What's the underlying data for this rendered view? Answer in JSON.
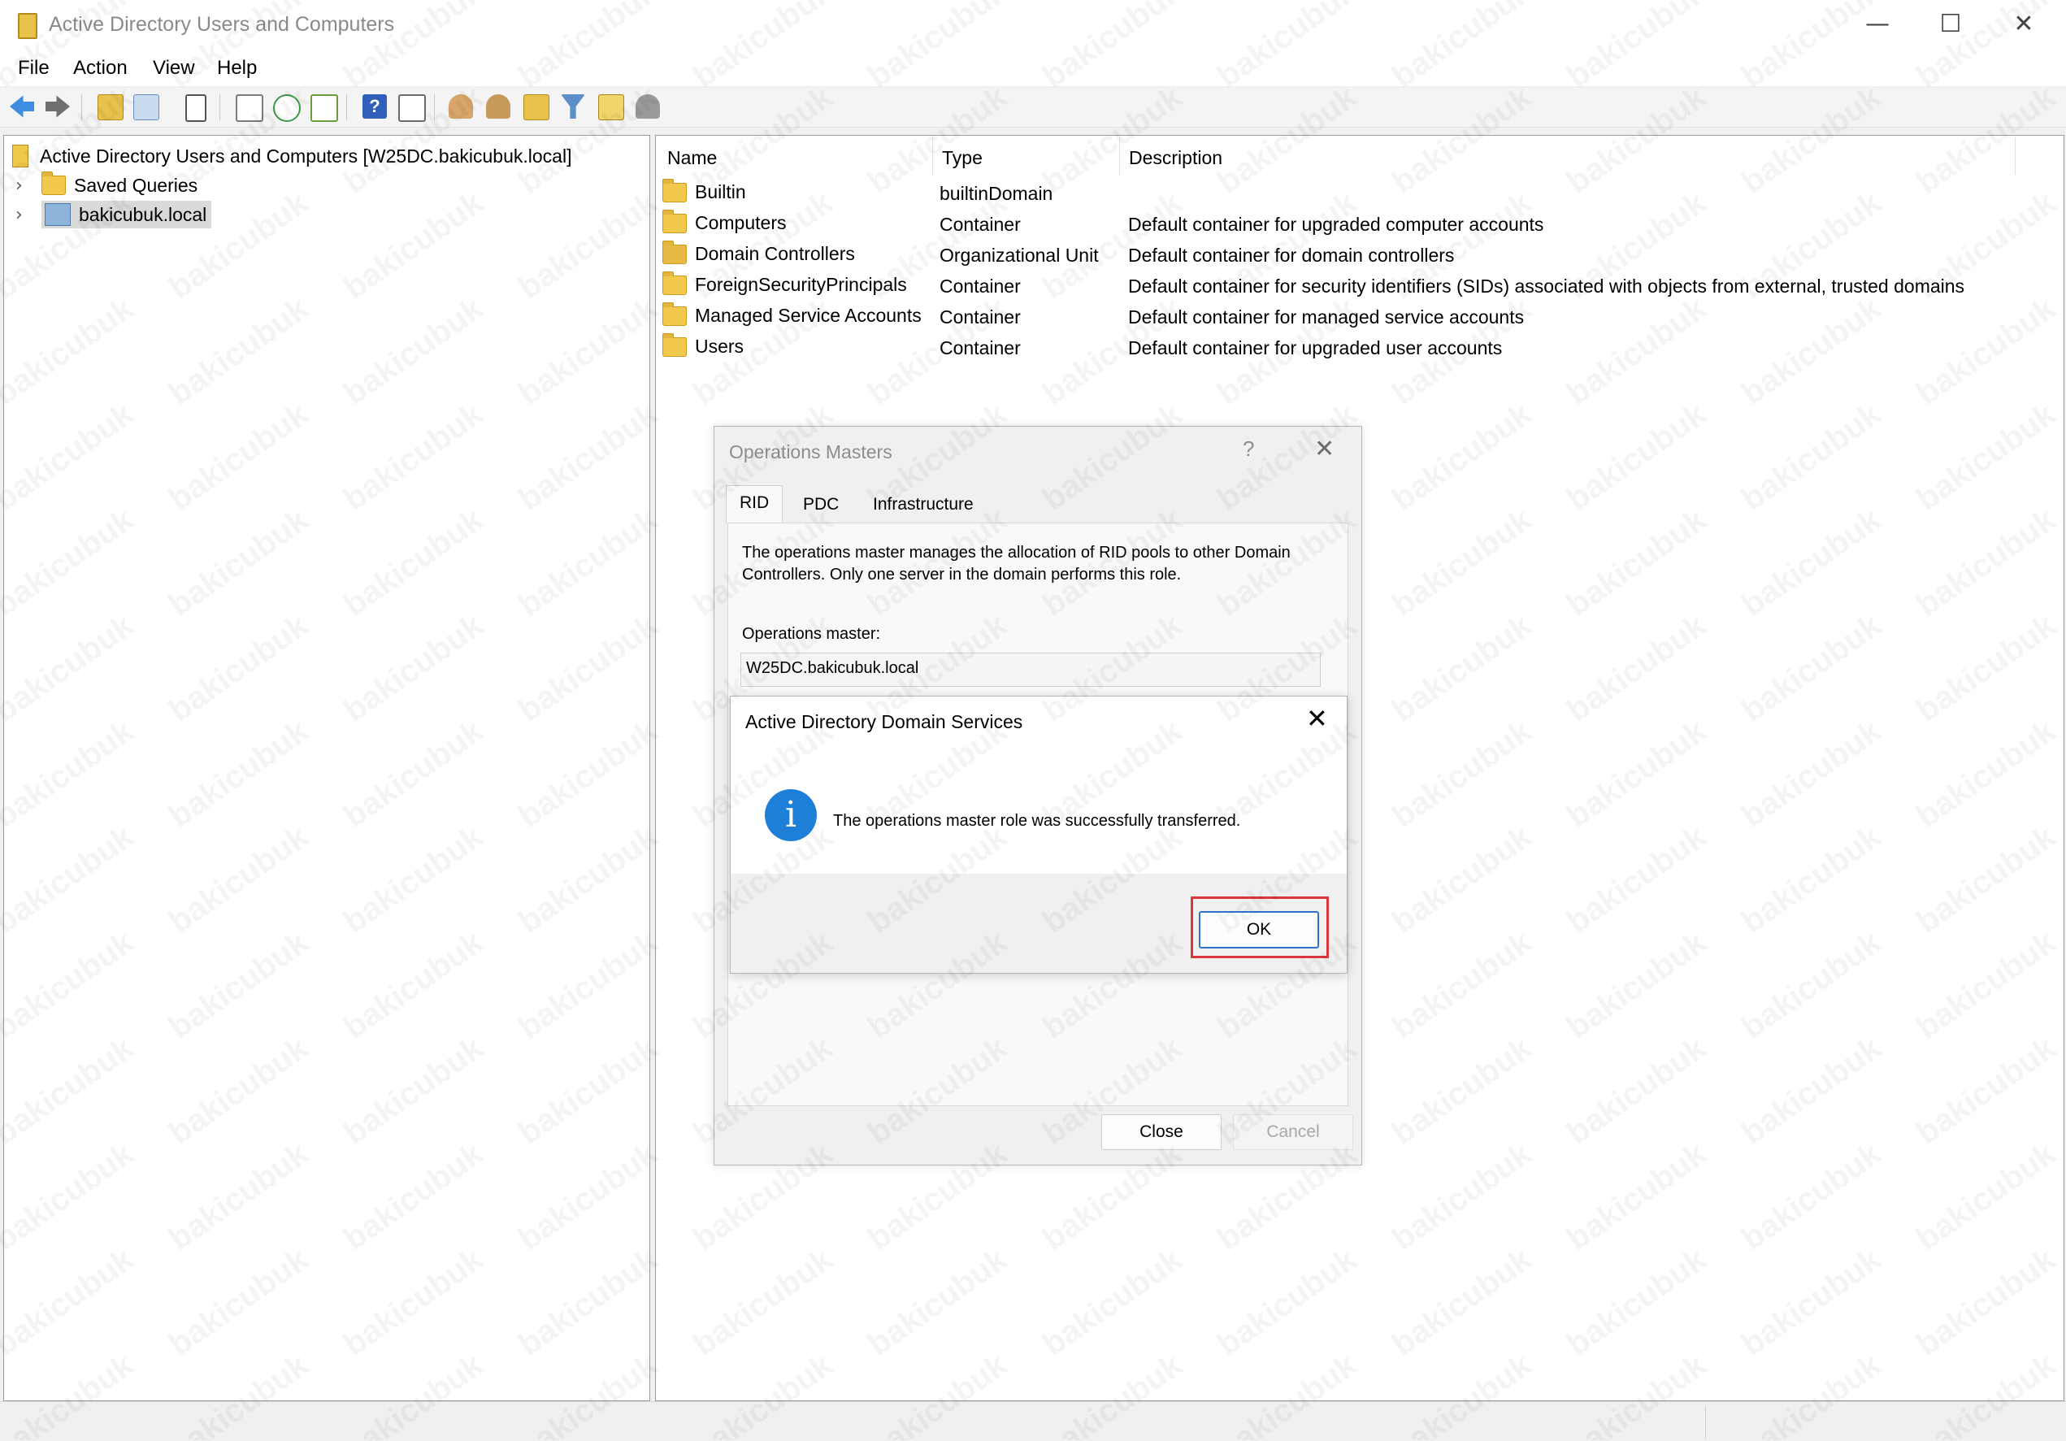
{
  "window": {
    "title": "Active Directory Users and Computers",
    "controls": {
      "minimize": "—",
      "maximize": "☐",
      "close": "✕"
    }
  },
  "menu": [
    "File",
    "Action",
    "View",
    "Help"
  ],
  "toolbar_icons": [
    "back-arrow-icon",
    "forward-arrow-icon",
    "up-folder-icon",
    "show-console-tree-icon",
    "clipboard-icon",
    "properties-icon",
    "refresh-icon",
    "export-list-icon",
    "help-icon",
    "show-action-pane-icon",
    "new-user-icon",
    "new-group-icon",
    "new-ou-icon",
    "filter-icon",
    "find-icon",
    "delegate-icon"
  ],
  "tree": {
    "root": "Active Directory Users and Computers [W25DC.bakicubuk.local]",
    "items": [
      {
        "label": "Saved Queries",
        "icon": "folder-icon"
      },
      {
        "label": "bakicubuk.local",
        "icon": "domain-icon",
        "selected": true
      }
    ]
  },
  "list": {
    "columns": [
      "Name",
      "Type",
      "Description"
    ],
    "rows": [
      {
        "name": "Builtin",
        "type": "builtinDomain",
        "description": ""
      },
      {
        "name": "Computers",
        "type": "Container",
        "description": "Default container for upgraded computer accounts"
      },
      {
        "name": "Domain Controllers",
        "type": "Organizational Unit",
        "description": "Default container for domain controllers"
      },
      {
        "name": "ForeignSecurityPrincipals",
        "type": "Container",
        "description": "Default container for security identifiers (SIDs) associated with objects from external, trusted domains"
      },
      {
        "name": "Managed Service Accounts",
        "type": "Container",
        "description": "Default container for managed service accounts"
      },
      {
        "name": "Users",
        "type": "Container",
        "description": "Default container for upgraded user accounts"
      }
    ]
  },
  "ops_dialog": {
    "title": "Operations Masters",
    "help": "?",
    "close": "✕",
    "tabs": [
      "RID",
      "PDC",
      "Infrastructure"
    ],
    "active_tab": "RID",
    "description": "The operations master manages the allocation of RID pools to other Domain Controllers. Only one server in the domain performs this role.",
    "master_label": "Operations master:",
    "master_value": "W25DC.bakicubuk.local",
    "close_button": "Close",
    "cancel_button": "Cancel"
  },
  "message_box": {
    "title": "Active Directory Domain Services",
    "close": "✕",
    "icon": "info-icon",
    "icon_glyph": "i",
    "text": "The operations master role was successfully transferred.",
    "ok_button": "OK",
    "highlight_color": "#d9363e"
  },
  "watermark": "bakicubuk"
}
